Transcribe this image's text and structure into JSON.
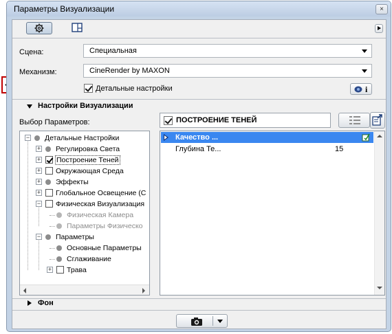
{
  "window": {
    "title": "Параметры Визуализации",
    "close_label": "×"
  },
  "toolbar": {
    "gear_icon": "gear-icon",
    "layout_icon": "layout-icon",
    "menu_icon": "play-icon"
  },
  "fields": {
    "scene_label": "Сцена:",
    "scene_value": "Специальная",
    "engine_label": "Механизм:",
    "engine_value": "CineRender by MAXON",
    "detail_checkbox_label": "Детальные настройки",
    "detail_checked": true,
    "info_button_label": "i"
  },
  "section": {
    "title": "Настройки Визуализации",
    "params_label": "Выбор Параметров:",
    "footer_title": "Фон"
  },
  "tree": [
    {
      "label": "Детальные Настройки",
      "icon": "dot",
      "expander": "−",
      "level": 0
    },
    {
      "label": "Регулировка Света",
      "icon": "dot",
      "expander": "+",
      "level": 1
    },
    {
      "label": "Построение Теней",
      "icon": "checkbox-checked",
      "expander": "+",
      "level": 1,
      "selected": true
    },
    {
      "label": "Окружающая Среда",
      "icon": "checkbox",
      "expander": "+",
      "level": 1
    },
    {
      "label": "Эффекты",
      "icon": "dot",
      "expander": "+",
      "level": 1
    },
    {
      "label": "Глобальное Освещение (С",
      "icon": "checkbox",
      "expander": "+",
      "level": 1
    },
    {
      "label": "Физическая Визуализация",
      "icon": "checkbox",
      "expander": "−",
      "level": 1
    },
    {
      "label": "Физическая Камера",
      "icon": "dot-light",
      "level": 2,
      "disabled": true
    },
    {
      "label": "Параметры Физическо",
      "icon": "dot-light",
      "level": 2,
      "disabled": true
    },
    {
      "label": "Параметры",
      "icon": "dot",
      "expander": "−",
      "level": 1
    },
    {
      "label": "Основные Параметры",
      "icon": "dot",
      "level": 2
    },
    {
      "label": "Сглаживание",
      "icon": "dot",
      "level": 2
    },
    {
      "label": "Трава",
      "icon": "checkbox",
      "expander": "+",
      "level": 2
    }
  ],
  "right_panel": {
    "header_label": "ПОСТРОЕНИЕ ТЕНЕЙ",
    "header_checked": true,
    "rows": [
      {
        "label": "Качество ...",
        "value": "",
        "highlighted": true
      },
      {
        "label": "Глубина Те...",
        "value": "15",
        "highlighted": false
      }
    ]
  },
  "bottom": {
    "camera_icon": "camera-icon",
    "dropdown_icon": "chevron-down-icon"
  },
  "colors": {
    "accent_blue": "#3a87f0",
    "highlight_row": "#3a87f0",
    "annotation_red": "#c00000"
  }
}
